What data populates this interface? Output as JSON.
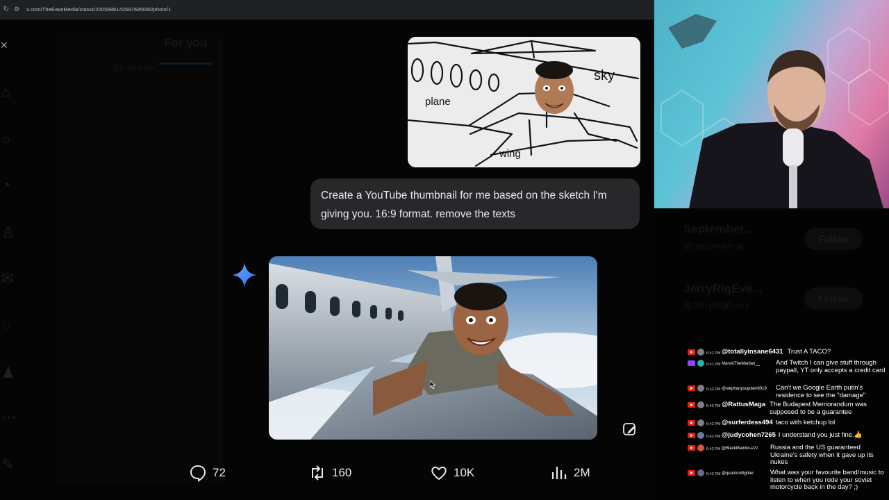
{
  "browser": {
    "url": "x.com/TheEaseMedia/status/2005688143597695090/photo/1"
  },
  "background": {
    "tab_label": "For you",
    "subtext": "It's so over..."
  },
  "sketch": {
    "labels": {
      "sky": "sky",
      "plane": "plane",
      "wing": "wing"
    }
  },
  "prompt": {
    "text": "Create a YouTube thumbnail for me based on the sketch I'm giving you. 16:9 format. remove the texts"
  },
  "actions": {
    "replies": "72",
    "reposts": "160",
    "likes": "10K",
    "views": "2M"
  },
  "right_column": {
    "rows": [
      {
        "name": "September...",
        "handle": "@septemberai",
        "follow": "Follow"
      },
      {
        "name": "JerryRigEve...",
        "handle": "@JerryRigEvery",
        "follow": "Follow"
      }
    ]
  },
  "chat": {
    "messages": [
      {
        "platform": "youtube",
        "time": "6:41 PM",
        "user": "@totallyinsane6431",
        "text": "Trust A TACO?"
      },
      {
        "platform": "twitch",
        "time": "6:41 PM",
        "user": "MarvinTheMartian__",
        "text": "And Twitch I can give stuff through paypall, YT only accepts a credit card"
      },
      {
        "platform": "youtube",
        "time": "6:42 PM",
        "user": "@stephanysuydam6019",
        "text": "Can't we Google Earth putin's residence to see the \"damage\""
      },
      {
        "platform": "youtube",
        "time": "6:42 PM",
        "user": "@RattusMaga",
        "text": "The Budapest Memorandum was supposed to be a guarantee"
      },
      {
        "platform": "youtube",
        "time": "6:42 PM",
        "user": "@surferdess494",
        "text": "taco with ketchup lol"
      },
      {
        "platform": "youtube",
        "time": "6:42 PM",
        "user": "@judycohen7265",
        "text": "I understand you just fine.👍"
      },
      {
        "platform": "youtube",
        "time": "6:42 PM",
        "user": "@BlackMambo-e7z",
        "text": "Russia and the US guaranteed Ukraine's safety when it gave up its nukes"
      },
      {
        "platform": "youtube",
        "time": "6:42 PM",
        "user": "@quantumfighter",
        "text": "What was your favourite band/music to listen to when you rode your soviet motorcycle back in the day? ;)"
      }
    ]
  },
  "colors": {
    "bubble": "#28282b",
    "gemini_blue": "#4285f4",
    "youtube_red": "#e62117",
    "twitch_purple": "#9147ff"
  }
}
